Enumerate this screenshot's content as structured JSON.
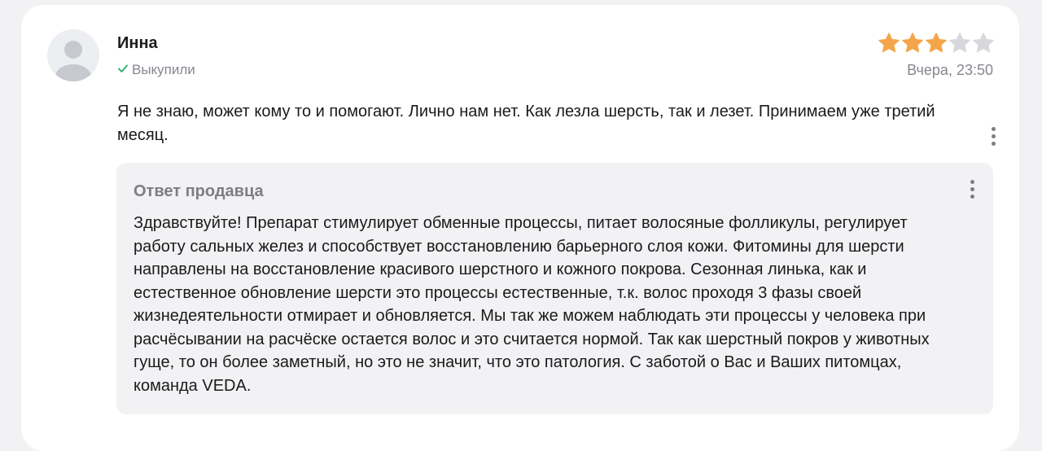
{
  "review": {
    "author": "Инна",
    "purchased_label": "Выкупили",
    "rating": 3,
    "rating_max": 5,
    "date": "Вчера, 23:50",
    "text": "Я не знаю, может кому то и помогают. Лично нам нет. Как лезла шерсть, так и лезет. Принимаем уже третий месяц."
  },
  "seller_reply": {
    "title": "Ответ продавца",
    "text": "Здравствуйте! Препарат стимулирует обменные процессы, питает волосяные фолликулы, регулирует работу сальных желез и способствует восстановлению барьерного слоя кожи. Фитомины для шерсти направлены на восстановление красивого шерстного и кожного покрова. Сезонная линька, как и естественное обновление шерсти это процессы естественные, т.к. волос проходя 3 фазы своей жизнедеятельности отмирает и обновляется. Мы так же можем наблюдать эти процессы у человека при расчёсывании на расчёске остается волос и это считается нормой. Так как шерстный покров у животных гуще, то он более заметный, но это не значит, что это патология. С заботой о Вас и Ваших питомцах, команда VEDA."
  },
  "colors": {
    "star_filled": "#f5a549",
    "star_empty": "#d7d7dc",
    "check": "#20b26b",
    "muted_text": "#86868f",
    "reply_background": "#f2f2f5"
  },
  "icons": {
    "avatar": "user-silhouette-icon",
    "check": "checkmark-icon",
    "star": "star-icon",
    "menu": "more-vertical-icon"
  }
}
